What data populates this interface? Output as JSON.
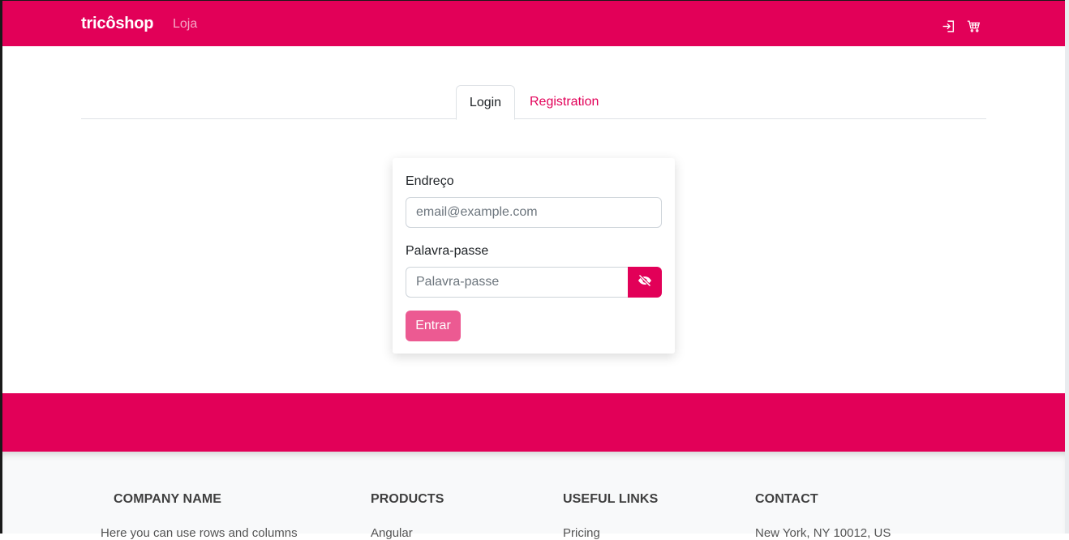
{
  "navbar": {
    "brand": "tricôshop",
    "link": "Loja",
    "icons": [
      "login-icon",
      "cart-icon"
    ],
    "color": "#e20058"
  },
  "tabs": [
    {
      "label": "Login",
      "active": true
    },
    {
      "label": "Registration",
      "active": false
    }
  ],
  "form": {
    "email_label": "Endreço",
    "email_placeholder": "email@example.com",
    "password_label": "Palavra-passe",
    "password_placeholder": "Palavra-passe",
    "toggle_icon": "eye-slash-icon",
    "submit_label": "Entrar"
  },
  "footer": {
    "columns": [
      {
        "title": "Company name",
        "text": "Here you can use rows and columns"
      },
      {
        "title": "Products",
        "text": "Angular"
      },
      {
        "title": "Useful links",
        "text": "Pricing"
      },
      {
        "title": "Contact",
        "text": "New York, NY 10012, US"
      }
    ]
  }
}
